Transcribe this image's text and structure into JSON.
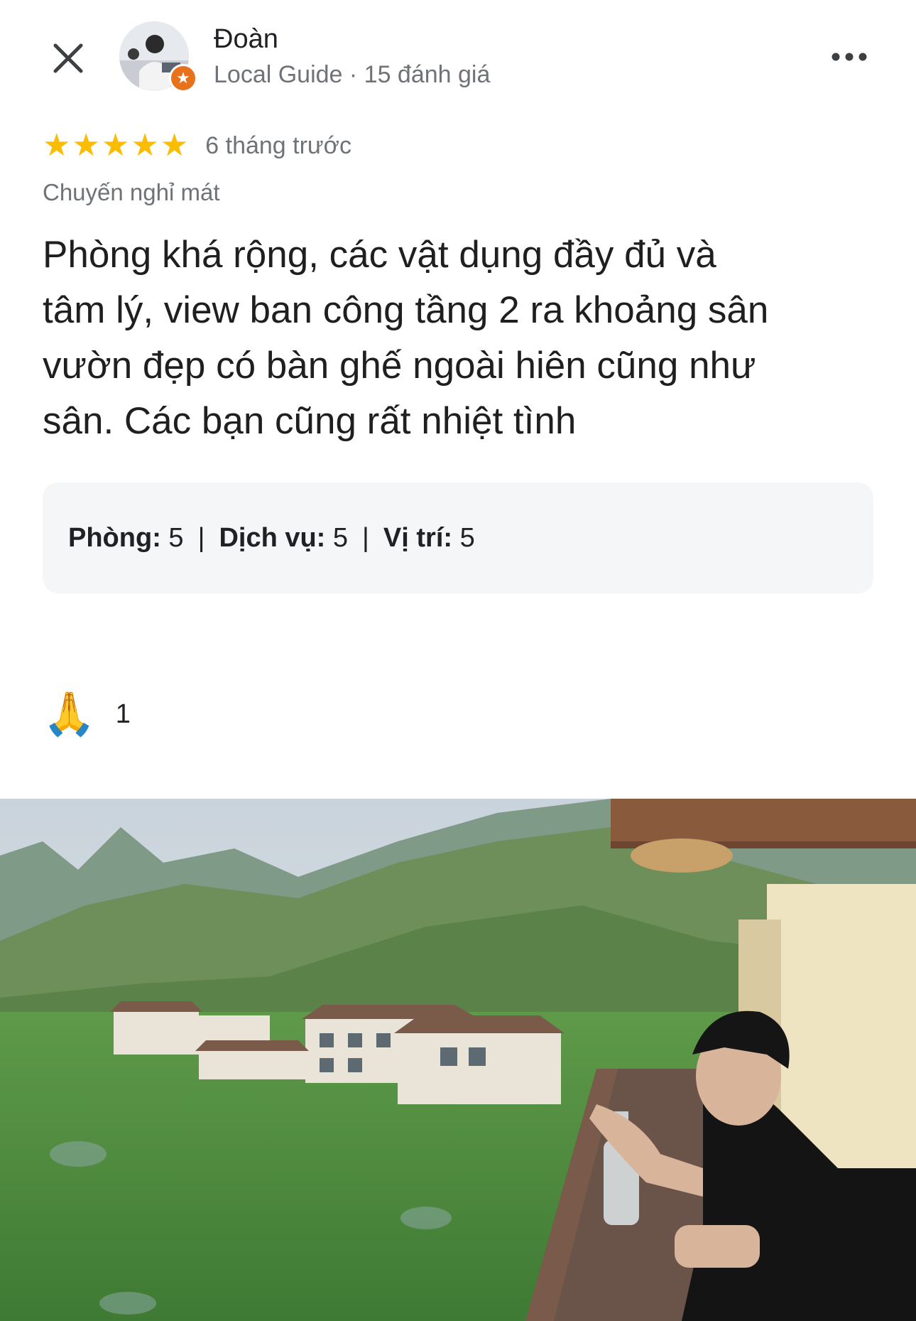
{
  "header": {
    "name": "Đoàn",
    "subtitle": "Local Guide · 15 đánh giá",
    "close_icon": "close-icon",
    "more_icon": "more-horizontal-icon"
  },
  "review": {
    "stars": 5,
    "max_stars": 5,
    "time": "6 tháng trước",
    "trip_type": "Chuyến nghỉ mát",
    "text_lines": [
      "Phòng khá rộng, các vật dụng đầy đủ và",
      "tâm lý, view ban công tầng 2 ra khoảng sân",
      "vườn đẹp có bàn ghế ngoài hiên cũng như",
      "sân. Các bạn cũng rất nhiệt tình"
    ]
  },
  "scores": {
    "room_label": "Phòng:",
    "room_value": "5",
    "service_label": "Dịch vụ:",
    "service_value": "5",
    "location_label": "Vị trí:",
    "location_value": "5",
    "separator": "|"
  },
  "reaction": {
    "emoji": "🙏",
    "count": "1"
  },
  "colors": {
    "star": "#fbbc04",
    "badge": "#e8711c",
    "secondary_text": "#6f7377",
    "score_bg": "#f5f6f7"
  }
}
